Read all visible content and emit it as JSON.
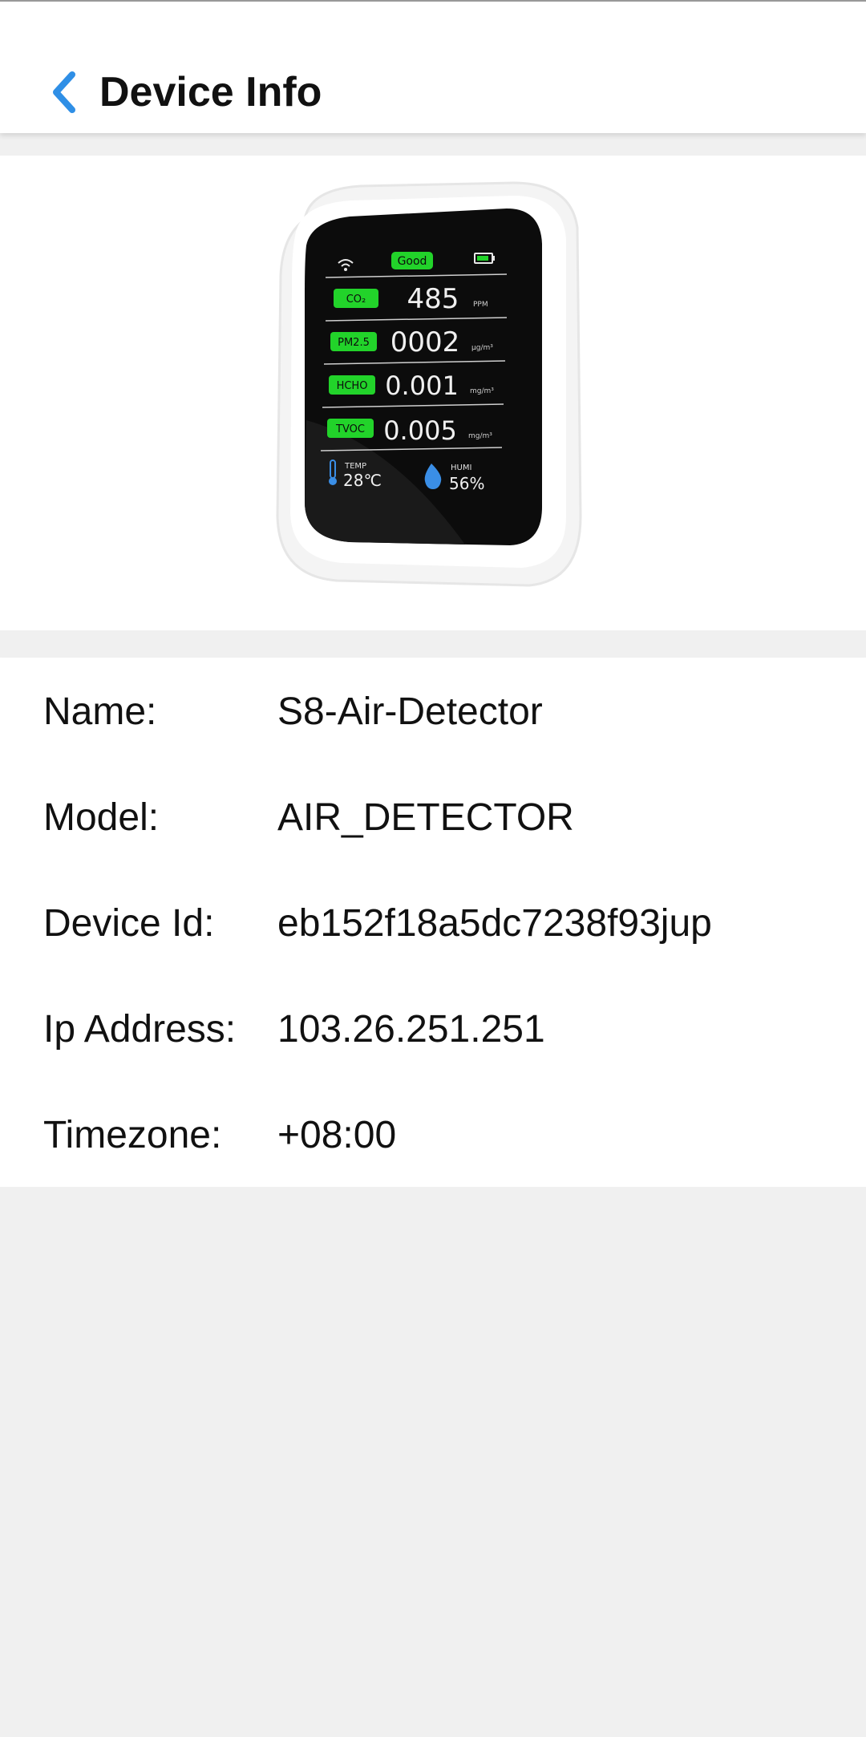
{
  "header": {
    "title": "Device Info",
    "back_icon": "chevron-left-icon",
    "accent_color": "#2f8fe6"
  },
  "device_image": {
    "screen": {
      "status": "Good",
      "readings": [
        {
          "badge": "CO₂",
          "value": "485",
          "unit": "PPM"
        },
        {
          "badge": "PM2.5",
          "value": "0002",
          "unit": "μg/m³"
        },
        {
          "badge": "HCHO",
          "value": "0.001",
          "unit": "mg/m³"
        },
        {
          "badge": "TVOC",
          "value": "0.005",
          "unit": "mg/m³"
        }
      ],
      "temp_label": "TEMP",
      "temp_value": "28℃",
      "humi_label": "HUMI",
      "humi_value": "56%",
      "badge_color": "#22d32a"
    }
  },
  "info": {
    "rows": [
      {
        "label": "Name:",
        "value": "S8-Air-Detector"
      },
      {
        "label": "Model:",
        "value": "AIR_DETECTOR"
      },
      {
        "label": "Device Id:",
        "value": "eb152f18a5dc7238f93jup"
      },
      {
        "label": "Ip Address:",
        "value": "103.26.251.251"
      },
      {
        "label": "Timezone:",
        "value": "+08:00"
      }
    ]
  }
}
